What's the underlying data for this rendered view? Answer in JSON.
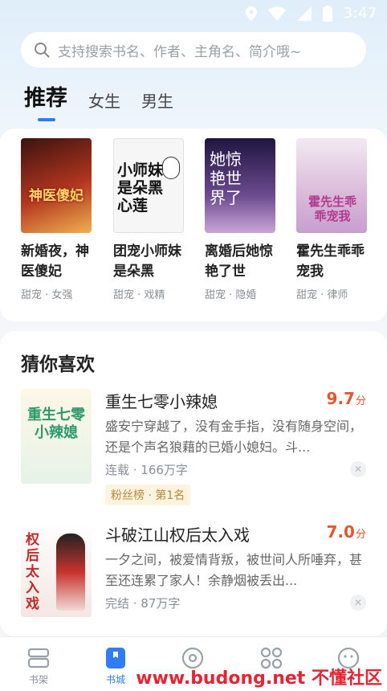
{
  "status": {
    "time": "3:47"
  },
  "search": {
    "placeholder": "支持搜索书名、作者、主角名、简介哦~"
  },
  "tabs": [
    {
      "label": "推荐"
    },
    {
      "label": "女生"
    },
    {
      "label": "男生"
    }
  ],
  "recommend": [
    {
      "title": "新婚夜，神医傻妃",
      "tags": "甜宠 · 女强",
      "cover_text": "神医傻妃",
      "cover_color": "#b23a2a"
    },
    {
      "title": "团宠小师妹是朵黑",
      "tags": "甜宠 · 戏精",
      "cover_text": "小师妹是朵黑心莲",
      "cover_color": "#f4f4f4"
    },
    {
      "title": "离婚后她惊艳了世",
      "tags": "甜宠 · 隐婚",
      "cover_text": "她惊艳世界了",
      "cover_color": "#5a3d78"
    },
    {
      "title": "霍先生乖乖宠我",
      "tags": "甜宠 · 律师",
      "cover_text": "霍先生乖乖宠我",
      "cover_color": "#e9d9ea"
    }
  ],
  "guess": {
    "heading": "猜你喜欢",
    "items": [
      {
        "name": "重生七零小辣媳",
        "score": "9.7",
        "score_unit": "分",
        "desc": "盛安宁穿越了，没有金手指，没有随身空间，还是个声名狼藉的已婚小媳妇。斗...",
        "meta": "连载 · 166万字",
        "badge": "粉丝榜 · 第1名",
        "cover_text": "重生七零小辣媳"
      },
      {
        "name": "斗破江山权后太入戏",
        "score": "7.0",
        "score_unit": "分",
        "desc": "一夕之间，被爱情背叛，被世间人所唾弃，甚至还连累了家人！余静烟被丢出...",
        "meta": "完结 · 87万字",
        "badge": "",
        "cover_text": "权后太入戏"
      }
    ]
  },
  "nav": [
    {
      "label": "书架"
    },
    {
      "label": "书城"
    },
    {
      "label": ""
    },
    {
      "label": ""
    },
    {
      "label": ""
    }
  ],
  "watermark": "www.budong.net 不懂社区",
  "colors": {
    "accent": "#2f7cf6",
    "score": "#e8552f"
  }
}
